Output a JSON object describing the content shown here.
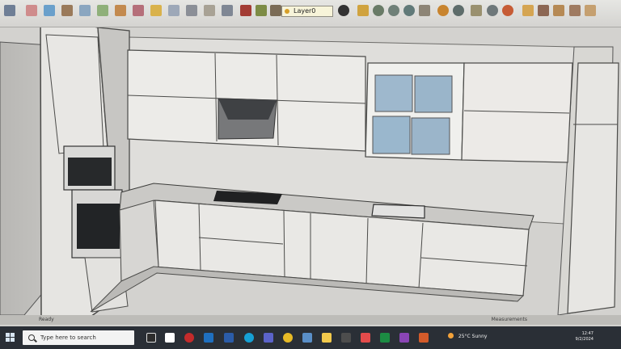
{
  "toolbar": {
    "layer_label": "Layer0",
    "icons": [
      "select-tool-icon",
      "eraser-tool-icon",
      "paint-bucket-icon",
      "line-tool-icon",
      "rectangle-tool-icon",
      "circle-tool-icon",
      "move-tool-icon",
      "rotate-tool-icon",
      "scale-tool-icon",
      "offset-tool-icon",
      "tape-measure-icon",
      "dimension-icon",
      "text-tool-icon",
      "axes-tool-icon",
      "orbit-tool-icon",
      "pan-tool-icon",
      "zoom-tool-icon",
      "zoom-extents-icon"
    ]
  },
  "viewport": {
    "scene": "SketchUp kitchen model",
    "colors": {
      "background": "#d3d2cf",
      "cabinet": "#e8e7e4",
      "line": "#4a4a48",
      "window": "#9db8cf",
      "black": "#222222"
    }
  },
  "status": {
    "text": "Ready",
    "measurements": "Measurements"
  },
  "taskbar": {
    "search_placeholder": "Type here to search",
    "weather_temp": "25°C",
    "weather_text": "Sunny",
    "time": "12:47",
    "date": "9/2/2024"
  }
}
